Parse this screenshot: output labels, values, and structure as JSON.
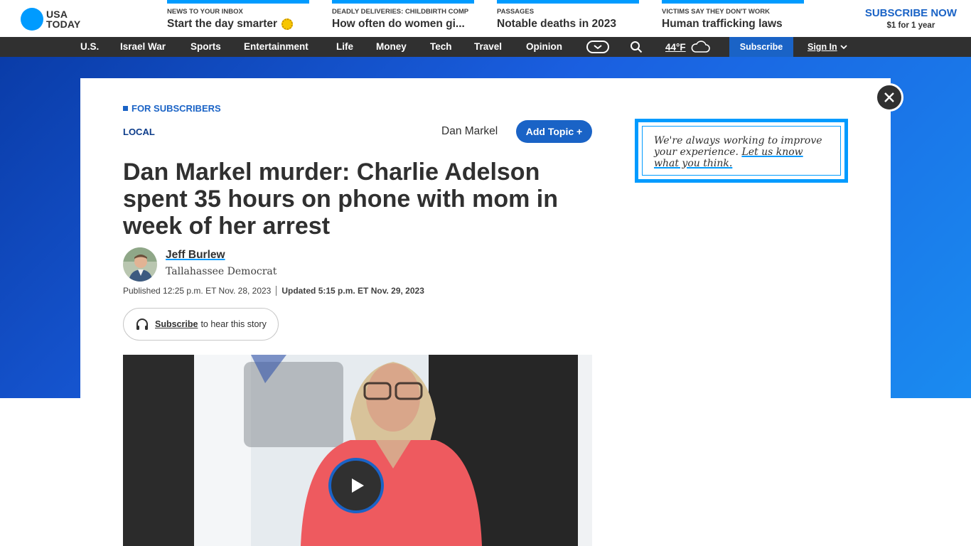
{
  "brand": {
    "logo_line1": "USA",
    "logo_line2": "TODAY"
  },
  "promos": [
    {
      "kicker": "NEWS TO YOUR INBOX",
      "headline": "Start the day smarter"
    },
    {
      "kicker": "DEADLY DELIVERIES: CHILDBIRTH COMP",
      "headline": "How often do women gi..."
    },
    {
      "kicker": "PASSAGES",
      "headline": "Notable deaths in 2023"
    },
    {
      "kicker": "VICTIMS SAY THEY DON'T WORK",
      "headline": "Human trafficking laws"
    }
  ],
  "subscribe_now": {
    "title": "SUBSCRIBE NOW",
    "subtitle": "$1 for 1 year"
  },
  "nav": {
    "items": [
      "U.S.",
      "Israel War",
      "Sports",
      "Entertainment",
      "Life",
      "Money",
      "Tech",
      "Travel",
      "Opinion"
    ],
    "weather": "44°F",
    "subscribe": "Subscribe",
    "sign_in": "Sign In"
  },
  "article": {
    "badge": "FOR SUBSCRIBERS",
    "section": "LOCAL",
    "topic": "Dan Markel",
    "add_topic": "Add Topic +",
    "headline": "Dan Markel murder: Charlie Adelson spent 35 hours on phone with mom in week of her arrest",
    "author": "Jeff Burlew",
    "outlet": "Tallahassee Democrat",
    "published": "Published 12:25 p.m. ET Nov. 28, 2023",
    "updated": "Updated 5:15 p.m. ET Nov. 29, 2023",
    "listen_link": "Subscribe",
    "listen_text": "to hear this story"
  },
  "feedback": {
    "text": "We're always working to improve your experience.",
    "link": "Let us know what you think."
  },
  "colors": {
    "accent": "#009bff",
    "brand_blue": "#1a63c6",
    "nav_bg": "#303030"
  }
}
